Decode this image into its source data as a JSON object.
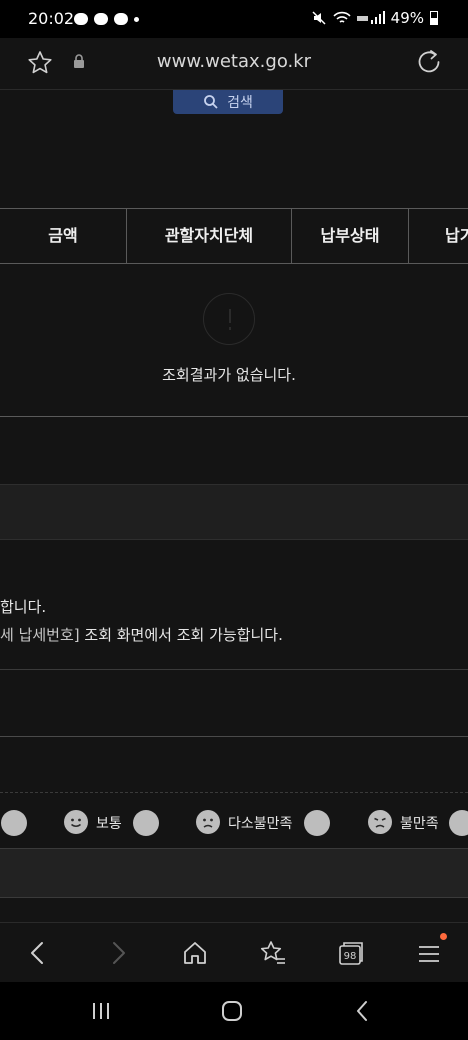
{
  "status_bar": {
    "time": "20:02",
    "battery": "49%"
  },
  "browser": {
    "url": "www.wetax.go.kr"
  },
  "search_button": {
    "label": "검색"
  },
  "table": {
    "headers": [
      "금액",
      "관할자치단체",
      "납부상태",
      "납기"
    ],
    "empty_message": "조회결과가 없습니다."
  },
  "notice": {
    "line1": "합니다.",
    "line2_link": "세 납세번호]",
    "line2_text": " 조회 화면에서 조회 가능합니다."
  },
  "survey": {
    "options": [
      "보통",
      "다소불만족",
      "불만족"
    ]
  },
  "bottom_nav": {
    "tab_count": "98"
  },
  "colors": {
    "background": "#141414",
    "search_button": "#2b4478",
    "menu_badge": "#ff6a3d"
  },
  "icons": [
    "star-icon",
    "lock-icon",
    "reload-icon",
    "search-icon",
    "back-icon",
    "forward-icon",
    "home-icon",
    "bookmarks-icon",
    "tabs-icon",
    "menu-icon"
  ]
}
